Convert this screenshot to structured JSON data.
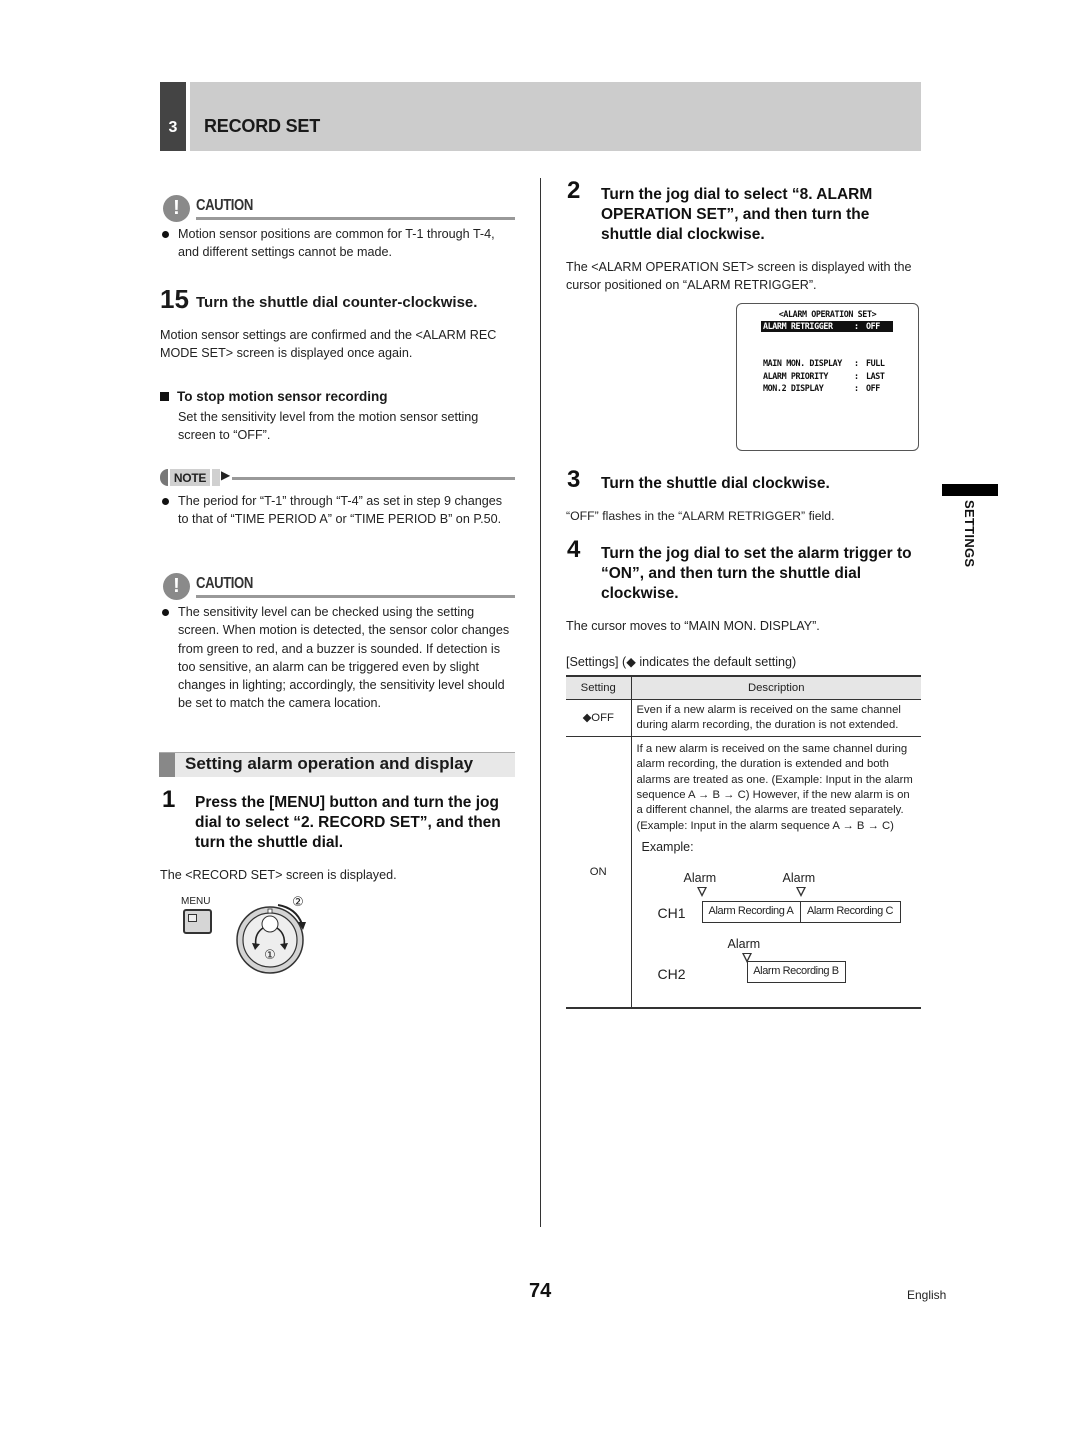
{
  "header": {
    "chapter_number": "3",
    "chapter_title": "RECORD SET"
  },
  "left_column": {
    "caution1": {
      "label": "CAUTION",
      "icon": "exclamation-circle-icon",
      "bullets": [
        "Motion sensor positions are common for T-1 through T-4, and different settings cannot be made."
      ]
    },
    "step15": {
      "number": "15",
      "title": "Turn the shuttle dial counter-clockwise.",
      "body": "Motion sensor settings are confirmed and the <ALARM REC MODE SET> screen is displayed once again."
    },
    "stop_recording": {
      "heading": "To stop motion sensor recording",
      "body": "Set the sensitivity level from the motion sensor setting screen to “OFF”."
    },
    "note": {
      "label": "NOTE",
      "bullets": [
        "The period for “T-1” through “T-4” as set in step 9 changes to that of “TIME PERIOD A” or “TIME PERIOD B” on P.50."
      ]
    },
    "caution2": {
      "label": "CAUTION",
      "icon": "exclamation-circle-icon",
      "bullets": [
        "The sensitivity level can be checked using the setting screen. When motion is detected, the sensor color changes from green to red, and a buzzer is sounded. If detection is too sensitive, an alarm can be triggered even by slight changes in lighting; accordingly, the sensitivity level should be set to match the camera location."
      ]
    },
    "section_heading": "Setting alarm operation and display",
    "step1": {
      "number": "1",
      "title": "Press the [MENU] button and turn the jog dial to select “2. RECORD SET”, and then turn the shuttle dial.",
      "body": "The <RECORD SET> screen is displayed.",
      "illustration": {
        "menu_label": "MENU",
        "dial_mark_1": "①",
        "dial_mark_2": "②"
      }
    }
  },
  "right_column": {
    "step2": {
      "number": "2",
      "title": "Turn the jog dial to select “8. ALARM OPERATION SET”, and then turn the shuttle dial clockwise.",
      "body": "The <ALARM OPERATION SET> screen is displayed with the cursor positioned on “ALARM RETRIGGER”."
    },
    "screen": {
      "title": "<ALARM OPERATION SET>",
      "rows": [
        {
          "key": "ALARM RETRIGGER",
          "sep": ":",
          "value": "OFF",
          "highlighted": true
        },
        {
          "key": "MAIN MON. DISPLAY",
          "sep": ":",
          "value": "FULL",
          "highlighted": false
        },
        {
          "key": "ALARM PRIORITY",
          "sep": ":",
          "value": "LAST",
          "highlighted": false
        },
        {
          "key": "MON.2 DISPLAY",
          "sep": ":",
          "value": "OFF",
          "highlighted": false
        }
      ]
    },
    "step3": {
      "number": "3",
      "title": "Turn the shuttle dial clockwise.",
      "body": "“OFF” flashes in the “ALARM RETRIGGER” field."
    },
    "step4": {
      "number": "4",
      "title": "Turn the jog dial to set the alarm trigger to “ON”, and then turn the shuttle dial clockwise.",
      "body": "The cursor moves to “MAIN MON. DISPLAY”."
    },
    "settings_caption": "[Settings] (◆ indicates the default setting)",
    "table": {
      "headers": [
        "Setting",
        "Description"
      ],
      "rows": [
        {
          "setting": "◆OFF",
          "description": "Even if a new alarm is received on the same channel during alarm recording, the duration is not extended."
        },
        {
          "setting": "ON",
          "description": "If a new alarm is received on the same channel during alarm recording, the duration is extended and both alarms are treated as one. (Example: Input in the alarm sequence A → B → C) However, if the new alarm is on a different channel, the alarms are treated separately. (Example: Input in the alarm sequence A → B → C)"
        }
      ],
      "example": {
        "label": "Example:",
        "alarm_label": "Alarm",
        "ch1": "CH1",
        "ch2": "CH2",
        "rec_a": "Alarm Recording A",
        "rec_b": "Alarm Recording B",
        "rec_c": "Alarm Recording C"
      }
    }
  },
  "side_tab": "SETTINGS",
  "footer": {
    "page_number": "74",
    "language": "English"
  }
}
